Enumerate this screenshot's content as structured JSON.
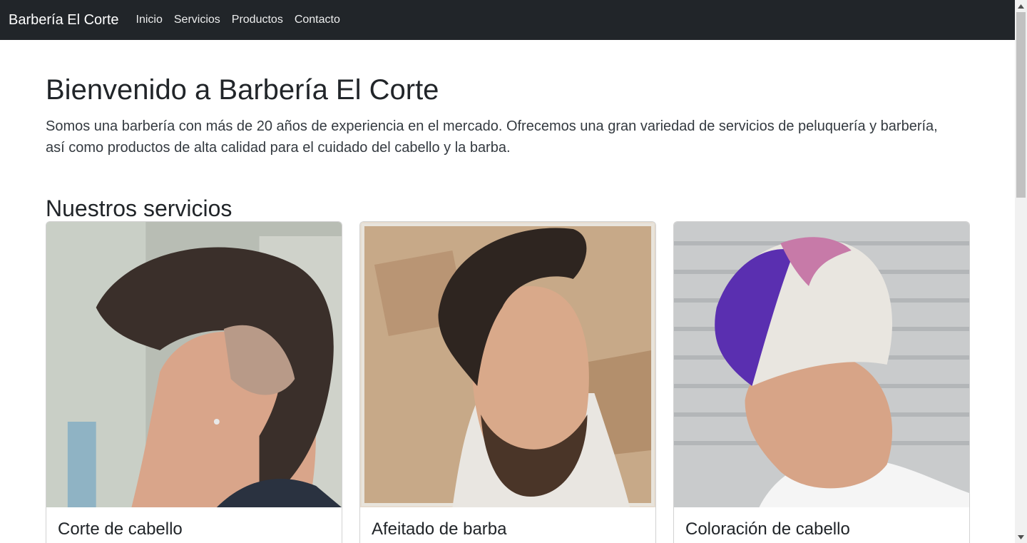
{
  "navbar": {
    "brand": "Barbería El Corte",
    "links": [
      "Inicio",
      "Servicios",
      "Productos",
      "Contacto"
    ]
  },
  "hero": {
    "title": "Bienvenido a Barbería El Corte",
    "text": "Somos una barbería con más de 20 años de experiencia en el mercado. Ofrecemos una gran variedad de servicios de peluquería y barbería, así como productos de alta calidad para el cuidado del cabello y la barba."
  },
  "services": {
    "heading": "Nuestros servicios",
    "cards": [
      {
        "title": "Corte de cabello"
      },
      {
        "title": "Afeitado de barba"
      },
      {
        "title": "Coloración de cabello"
      }
    ]
  },
  "colors": {
    "navbar_bg": "#212529",
    "text": "#212529"
  }
}
